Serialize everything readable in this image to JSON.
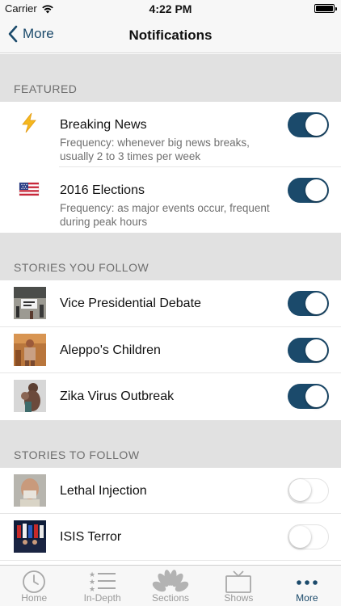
{
  "status_bar": {
    "carrier": "Carrier",
    "time": "4:22 PM"
  },
  "nav": {
    "back_label": "More",
    "title": "Notifications"
  },
  "colors": {
    "accent": "#1b4a6b",
    "section_bg": "#e1e1e1",
    "toggle_on": "#1b4a6b"
  },
  "sections": {
    "featured": {
      "header": "FEATURED",
      "items": [
        {
          "title": "Breaking News",
          "description": "Frequency: whenever big news breaks, usually 2 to 3 times per week",
          "icon": "lightning-icon",
          "enabled": true
        },
        {
          "title": "2016 Elections",
          "description": "Frequency: as major events occur, frequent during peak hours",
          "icon": "us-flag-icon",
          "enabled": true
        }
      ]
    },
    "following": {
      "header": "STORIES YOU FOLLOW",
      "items": [
        {
          "title": "Vice Presidential Debate",
          "enabled": true
        },
        {
          "title": "Aleppo's Children",
          "enabled": true
        },
        {
          "title": "Zika Virus Outbreak",
          "enabled": true
        }
      ]
    },
    "to_follow": {
      "header": "STORIES TO FOLLOW",
      "items": [
        {
          "title": "Lethal Injection",
          "enabled": false
        },
        {
          "title": "ISIS Terror",
          "enabled": false
        }
      ]
    }
  },
  "tab_bar": {
    "tabs": [
      {
        "label": "Home",
        "icon": "clock-icon"
      },
      {
        "label": "In-Depth",
        "icon": "star-list-icon"
      },
      {
        "label": "Sections",
        "icon": "peacock-icon"
      },
      {
        "label": "Shows",
        "icon": "tv-icon"
      },
      {
        "label": "More",
        "icon": "more-dots-icon",
        "active": true
      }
    ]
  }
}
